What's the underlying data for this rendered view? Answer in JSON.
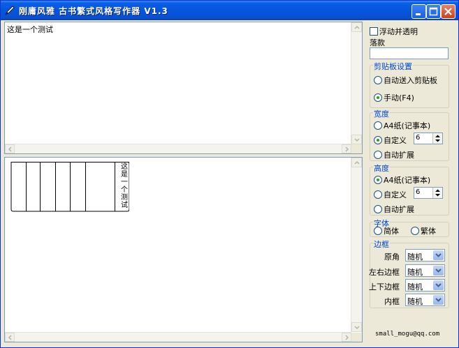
{
  "window": {
    "title": "刚庸风雅  古书繁式风格写作器  V1.3",
    "controls": [
      "minimize",
      "maximize",
      "close"
    ]
  },
  "editor": {
    "input_text": "这是一个测试",
    "preview_vertical_text": "这是一个测试"
  },
  "options": {
    "float_transparent_label": "浮动并透明",
    "float_transparent_checked": false,
    "caption_label": "落款",
    "caption_value": "",
    "clipboard": {
      "title": "剪贴板设置",
      "auto_label": "自动送入剪贴板",
      "manual_label": "手动(F4)",
      "selected": "manual"
    },
    "width": {
      "title": "宽度",
      "a4_label": "A4纸(记事本)",
      "custom_label": "自定义",
      "custom_value": "6",
      "auto_label": "自动扩展",
      "selected": "custom"
    },
    "height": {
      "title": "高度",
      "a4_label": "A4纸(记事本)",
      "custom_label": "自定义",
      "custom_value": "6",
      "auto_label": "自动扩展",
      "selected": "a4"
    },
    "font": {
      "title": "字体",
      "simplified_label": "简体",
      "traditional_label": "繁体",
      "selected": "none"
    },
    "border": {
      "title": "边框",
      "rows": [
        {
          "label": "原角",
          "value": "随机"
        },
        {
          "label": "左右边框",
          "value": "随机"
        },
        {
          "label": "上下边框",
          "value": "随机"
        },
        {
          "label": "内框",
          "value": "随机"
        }
      ]
    },
    "email": "small_mogu@qq.com"
  },
  "colors": {
    "titlebar": "#0556dd",
    "window_bg": "#ece9d8",
    "group_title": "#0046d5",
    "radio_dot": "#21a121",
    "close_button": "#c8421f"
  },
  "icons": {
    "app": "quill-icon",
    "minimize": "minimize-icon",
    "maximize": "maximize-icon",
    "close": "close-icon",
    "scroll_up": "scroll-up-arrow-icon",
    "scroll_down": "scroll-down-arrow-icon",
    "scroll_left": "scroll-left-arrow-icon",
    "scroll_right": "scroll-right-arrow-icon",
    "dropdown": "chevron-down-icon"
  }
}
